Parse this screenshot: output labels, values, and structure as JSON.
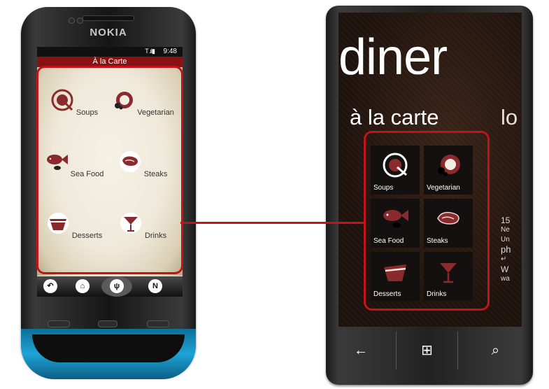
{
  "nokia": {
    "brand": "NOKIA",
    "status_time": "9:48",
    "status_signal": "T .ıl▮",
    "header_title": "À la Carte",
    "menu": [
      {
        "label": "Soups",
        "icon": "soup-bowl-icon"
      },
      {
        "label": "Vegetarian",
        "icon": "coconut-icon"
      },
      {
        "label": "Sea Food",
        "icon": "fish-icon"
      },
      {
        "label": "Steaks",
        "icon": "steak-icon"
      },
      {
        "label": "Desserts",
        "icon": "cake-slice-icon"
      },
      {
        "label": "Drinks",
        "icon": "cocktail-glass-icon"
      }
    ],
    "toolbar": [
      {
        "icon": "back-icon",
        "glyph": "↶"
      },
      {
        "icon": "home-icon",
        "glyph": "⌂"
      },
      {
        "icon": "cutlery-icon",
        "glyph": "ψ"
      },
      {
        "icon": "navigation-icon",
        "glyph": "N"
      }
    ]
  },
  "wp": {
    "app_title": "diner",
    "section_title": "à la carte",
    "next_section_peek": "lo",
    "side_info": [
      "15",
      "Ne",
      "Un",
      "ph",
      "↵",
      "W",
      "wa"
    ],
    "menu": [
      {
        "label": "Soups",
        "icon": "soup-bowl-icon"
      },
      {
        "label": "Vegetarian",
        "icon": "coconut-icon"
      },
      {
        "label": "Sea Food",
        "icon": "fish-icon"
      },
      {
        "label": "Steaks",
        "icon": "steak-icon"
      },
      {
        "label": "Desserts",
        "icon": "cake-slice-icon"
      },
      {
        "label": "Drinks",
        "icon": "cocktail-glass-icon"
      }
    ],
    "hardware_buttons": [
      {
        "icon": "back-arrow-icon",
        "glyph": "←"
      },
      {
        "icon": "windows-start-icon",
        "glyph": "⊞"
      },
      {
        "icon": "search-icon",
        "glyph": "⌕"
      }
    ]
  },
  "colors": {
    "highlight": "#c0141a",
    "nokia_accent": "#8a1111",
    "icon_maroon": "#8b2a2c"
  }
}
